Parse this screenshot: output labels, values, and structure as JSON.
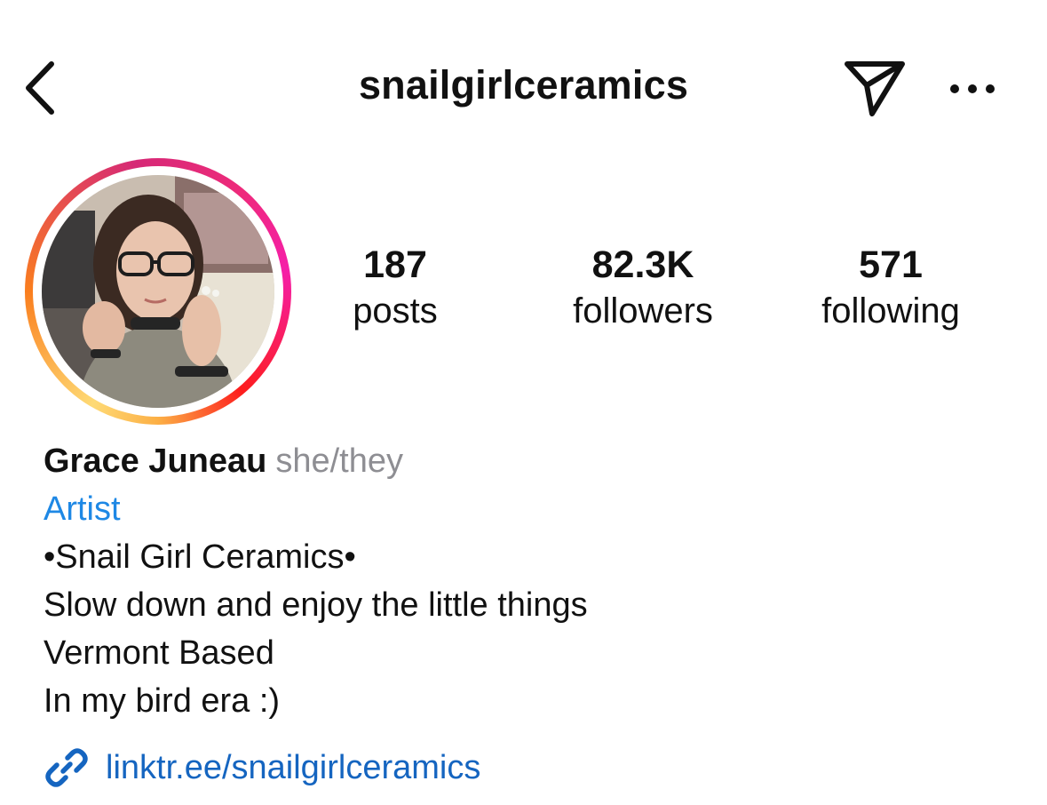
{
  "header": {
    "username": "snailgirlceramics",
    "back_icon": "chevron-left-icon",
    "send_icon": "paper-plane-icon",
    "more_icon": "ellipsis-icon"
  },
  "profile": {
    "avatar_icon": "profile-photo",
    "story_ring_colors": [
      "#feda75",
      "#fa7e1e",
      "#d62976",
      "#f51fa8",
      "#fcaf45"
    ]
  },
  "stats": {
    "posts": {
      "count": "187",
      "label": "posts"
    },
    "followers": {
      "count": "82.3K",
      "label": "followers"
    },
    "following": {
      "count": "571",
      "label": "following"
    }
  },
  "bio": {
    "name": "Grace Juneau",
    "pronouns": "she/they",
    "category": "Artist",
    "lines": [
      "•Snail Girl Ceramics•",
      "Slow down and enjoy the little things",
      "Vermont Based",
      "In my bird era :)"
    ],
    "link": "linktr.ee/snailgirlceramics",
    "link_icon": "link-icon"
  },
  "colors": {
    "link_blue": "#1565c0",
    "category_blue": "#1e88e5",
    "pronoun_gray": "#8e8e93",
    "text": "#111111"
  }
}
